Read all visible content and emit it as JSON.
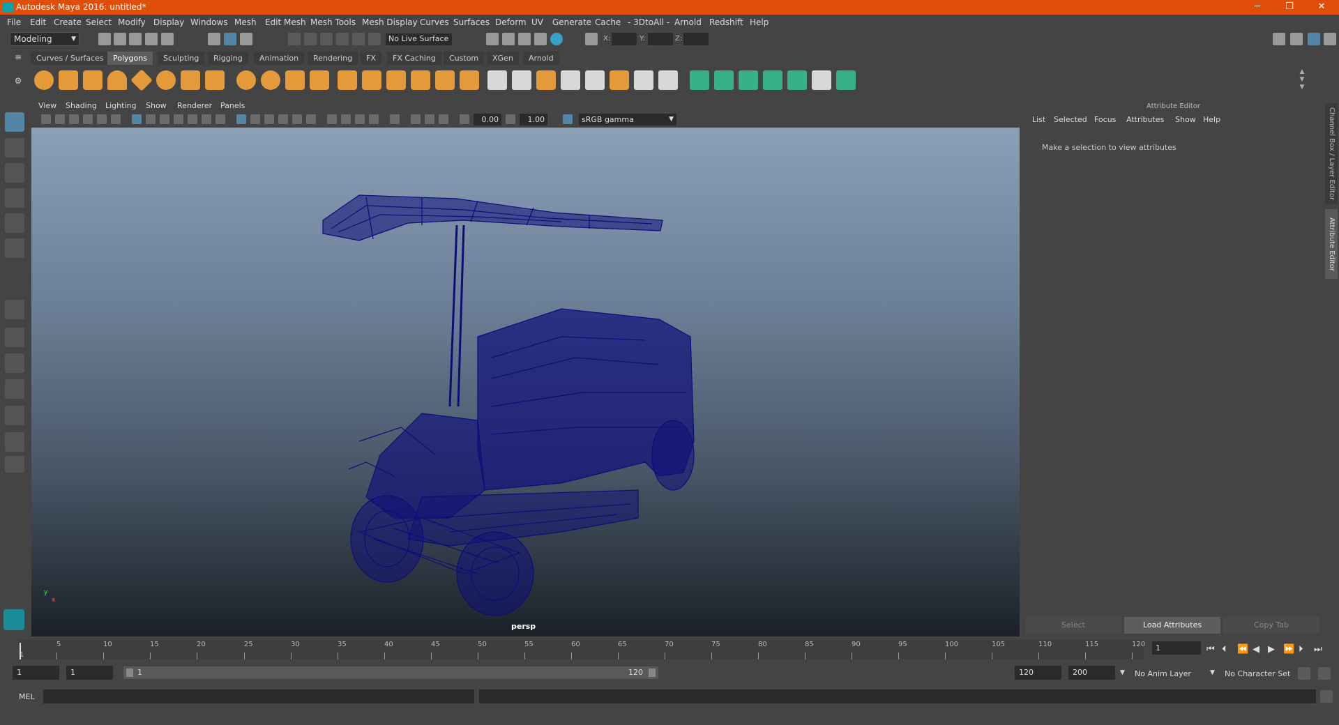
{
  "window": {
    "title": "Autodesk Maya 2016: untitled*",
    "minimize": "─",
    "restore": "❐",
    "close": "✕"
  },
  "menubar": [
    "File",
    "Edit",
    "Create",
    "Select",
    "Modify",
    "Display",
    "Windows",
    "Mesh",
    "Edit Mesh",
    "Mesh Tools",
    "Mesh Display",
    "Curves",
    "Surfaces",
    "Deform",
    "UV",
    "Generate",
    "Cache",
    "- 3DtoAll -",
    "Arnold",
    "Redshift",
    "Help"
  ],
  "status": {
    "mode": "Modeling",
    "live_surface": "No Live Surface",
    "x_label": "X:",
    "y_label": "Y:",
    "z_label": "Z:"
  },
  "shelf_tabs": [
    "Curves / Surfaces",
    "Polygons",
    "Sculpting",
    "Rigging",
    "Animation",
    "Rendering",
    "FX",
    "FX Caching",
    "Custom",
    "XGen",
    "Arnold"
  ],
  "shelf_active_tab": "Polygons",
  "viewport": {
    "menu": [
      "View",
      "Shading",
      "Lighting",
      "Show",
      "Renderer",
      "Panels"
    ],
    "exposure": "0.00",
    "gamma": "1.00",
    "color_space": "sRGB gamma",
    "camera_label": "persp",
    "axis_y": "y",
    "axis_x": "x"
  },
  "attribute_editor": {
    "title": "Attribute Editor",
    "menu": [
      "List",
      "Selected",
      "Focus",
      "Attributes",
      "Show",
      "Help"
    ],
    "message": "Make a selection to view attributes",
    "select_button": "Select",
    "load_button": "Load Attributes",
    "copy_button": "Copy Tab"
  },
  "side_tabs": {
    "channel_box": "Channel Box / Layer Editor",
    "attribute_editor": "Attribute Editor"
  },
  "timeline": {
    "ticks": [
      "5",
      "10",
      "15",
      "20",
      "25",
      "30",
      "35",
      "40",
      "45",
      "50",
      "55",
      "60",
      "65",
      "70",
      "75",
      "80",
      "85",
      "90",
      "95",
      "100",
      "105",
      "110",
      "115",
      "120"
    ],
    "first_label": "1",
    "current_frame": "1"
  },
  "range": {
    "start": "1",
    "playback_start": "1",
    "bar_start": "1",
    "bar_end": "120",
    "playback_end": "120",
    "end": "200",
    "anim_layer": "No Anim Layer",
    "character_set": "No Character Set"
  },
  "command_line": {
    "label": "MEL"
  },
  "colors": {
    "title_bar": "#e04e0c",
    "wireframe": "#0d0d7a",
    "active_tool": "#5285a6",
    "polygon_shelf_icon": "#e59a3a"
  }
}
